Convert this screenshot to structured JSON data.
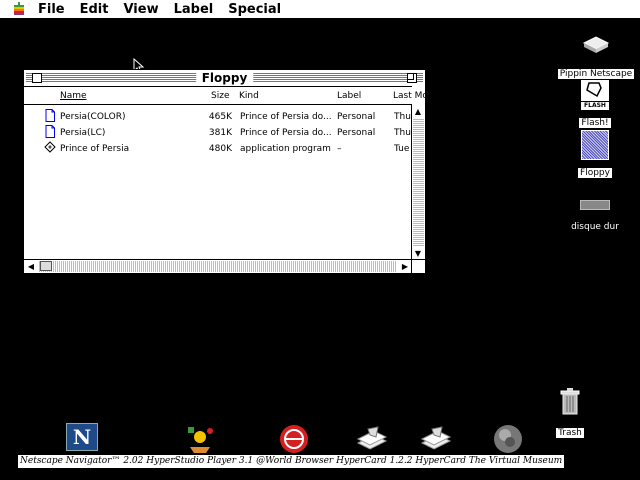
{
  "menubar": {
    "items": [
      "File",
      "Edit",
      "View",
      "Label",
      "Special"
    ]
  },
  "window": {
    "title": "Floppy",
    "columns": {
      "name": "Name",
      "size": "Size",
      "kind": "Kind",
      "label": "Label",
      "modified": "Last Mo"
    },
    "rows": [
      {
        "icon": "document-icon",
        "name": "Persia(COLOR)",
        "size": "465K",
        "kind": "Prince of Persia do...",
        "label": "Personal",
        "modified": "Thu"
      },
      {
        "icon": "document-icon",
        "name": "Persia(LC)",
        "size": "381K",
        "kind": "Prince of Persia do...",
        "label": "Personal",
        "modified": "Thu"
      },
      {
        "icon": "application-icon",
        "name": "Prince of Persia",
        "size": "480K",
        "kind": "application program",
        "label": "–",
        "modified": "Tue"
      }
    ]
  },
  "desktop_icons": {
    "pippin": "Pippin Netscape",
    "flash": "Flash!",
    "flash_caption": "FLASH",
    "floppy": "Floppy",
    "disk": "disque dur",
    "trash": "Trash"
  },
  "dock": {
    "caption": "Netscape Navigator™ 2.02  HyperStudio Player 3.1  @World Browser HyperCard 1.2.2 HyperCard  The Virtual Museum",
    "netscape_letter": "N"
  },
  "colors": {
    "desktop": "#000000",
    "netscape_blue": "#1f4a8a",
    "world_red": "#d42020"
  }
}
